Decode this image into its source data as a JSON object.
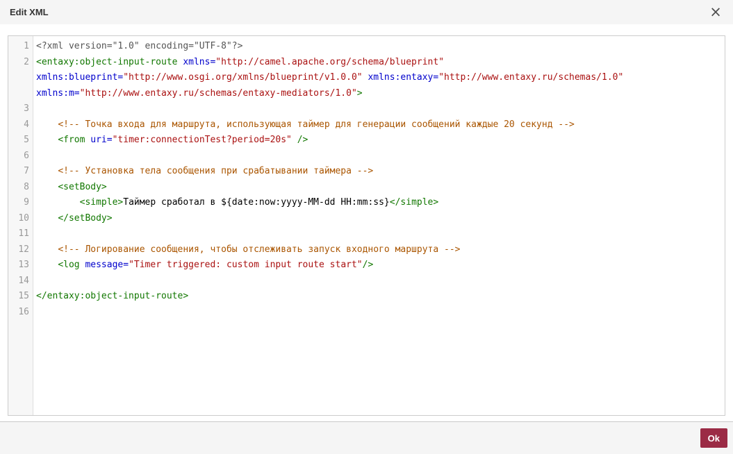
{
  "dialog": {
    "title": "Edit XML",
    "close_icon": "×"
  },
  "editor": {
    "language": "xml",
    "line_count": 16,
    "lines": [
      [
        [
          "meta",
          "<?xml version=\"1.0\" encoding=\"UTF-8\"?>"
        ]
      ],
      [
        [
          "tag",
          "<entaxy:object-input-route"
        ],
        [
          "pln",
          " "
        ],
        [
          "attr",
          "xmlns="
        ],
        [
          "str",
          "\"http://camel.apache.org/schema/blueprint\""
        ],
        [
          "pln",
          " "
        ],
        [
          "attr",
          "xmlns:blueprint="
        ],
        [
          "str",
          "\"http://www.osgi.org/xmlns/blueprint/v1.0.0\""
        ],
        [
          "pln",
          " "
        ],
        [
          "attr",
          "xmlns:entaxy="
        ],
        [
          "str",
          "\"http://www.entaxy.ru/schemas/1.0\""
        ],
        [
          "pln",
          " "
        ],
        [
          "attr",
          "xmlns:m="
        ],
        [
          "str",
          "\"http://www.entaxy.ru/schemas/entaxy-mediators/1.0\""
        ],
        [
          "tag",
          ">"
        ]
      ],
      [],
      [
        [
          "pln",
          "    "
        ],
        [
          "com",
          "<!-- Точка входа для маршрута, использующая таймер для генерации сообщений каждые 20 секунд -->"
        ]
      ],
      [
        [
          "pln",
          "    "
        ],
        [
          "tag",
          "<from"
        ],
        [
          "pln",
          " "
        ],
        [
          "attr",
          "uri="
        ],
        [
          "str",
          "\"timer:connectionTest?period=20s\""
        ],
        [
          "pln",
          " "
        ],
        [
          "tag",
          "/>"
        ]
      ],
      [],
      [
        [
          "pln",
          "    "
        ],
        [
          "com",
          "<!-- Установка тела сообщения при срабатывании таймера -->"
        ]
      ],
      [
        [
          "pln",
          "    "
        ],
        [
          "tag",
          "<setBody>"
        ]
      ],
      [
        [
          "pln",
          "        "
        ],
        [
          "tag",
          "<simple>"
        ],
        [
          "pln",
          "Таймер сработал в ${date:now:yyyy-MM-dd HH:mm:ss}"
        ],
        [
          "tag",
          "</simple>"
        ]
      ],
      [
        [
          "pln",
          "    "
        ],
        [
          "tag",
          "</setBody>"
        ]
      ],
      [],
      [
        [
          "pln",
          "    "
        ],
        [
          "com",
          "<!-- Логирование сообщения, чтобы отслеживать запуск входного маршрута -->"
        ]
      ],
      [
        [
          "pln",
          "    "
        ],
        [
          "tag",
          "<log"
        ],
        [
          "pln",
          " "
        ],
        [
          "attr",
          "message="
        ],
        [
          "str",
          "\"Timer triggered: custom input route start\""
        ],
        [
          "tag",
          "/>"
        ]
      ],
      [],
      [
        [
          "tag",
          "</entaxy:object-input-route>"
        ]
      ],
      []
    ]
  },
  "footer": {
    "ok_label": "Ok"
  },
  "colors": {
    "accent": "#9b2b45",
    "syntax_meta": "#555555",
    "syntax_tag": "#117700",
    "syntax_attribute": "#0000cc",
    "syntax_string": "#aa1111",
    "syntax_comment": "#aa5500",
    "gutter_bg": "#f7f7f7",
    "line_number": "#999999",
    "header_bg": "#f5f5f5"
  }
}
